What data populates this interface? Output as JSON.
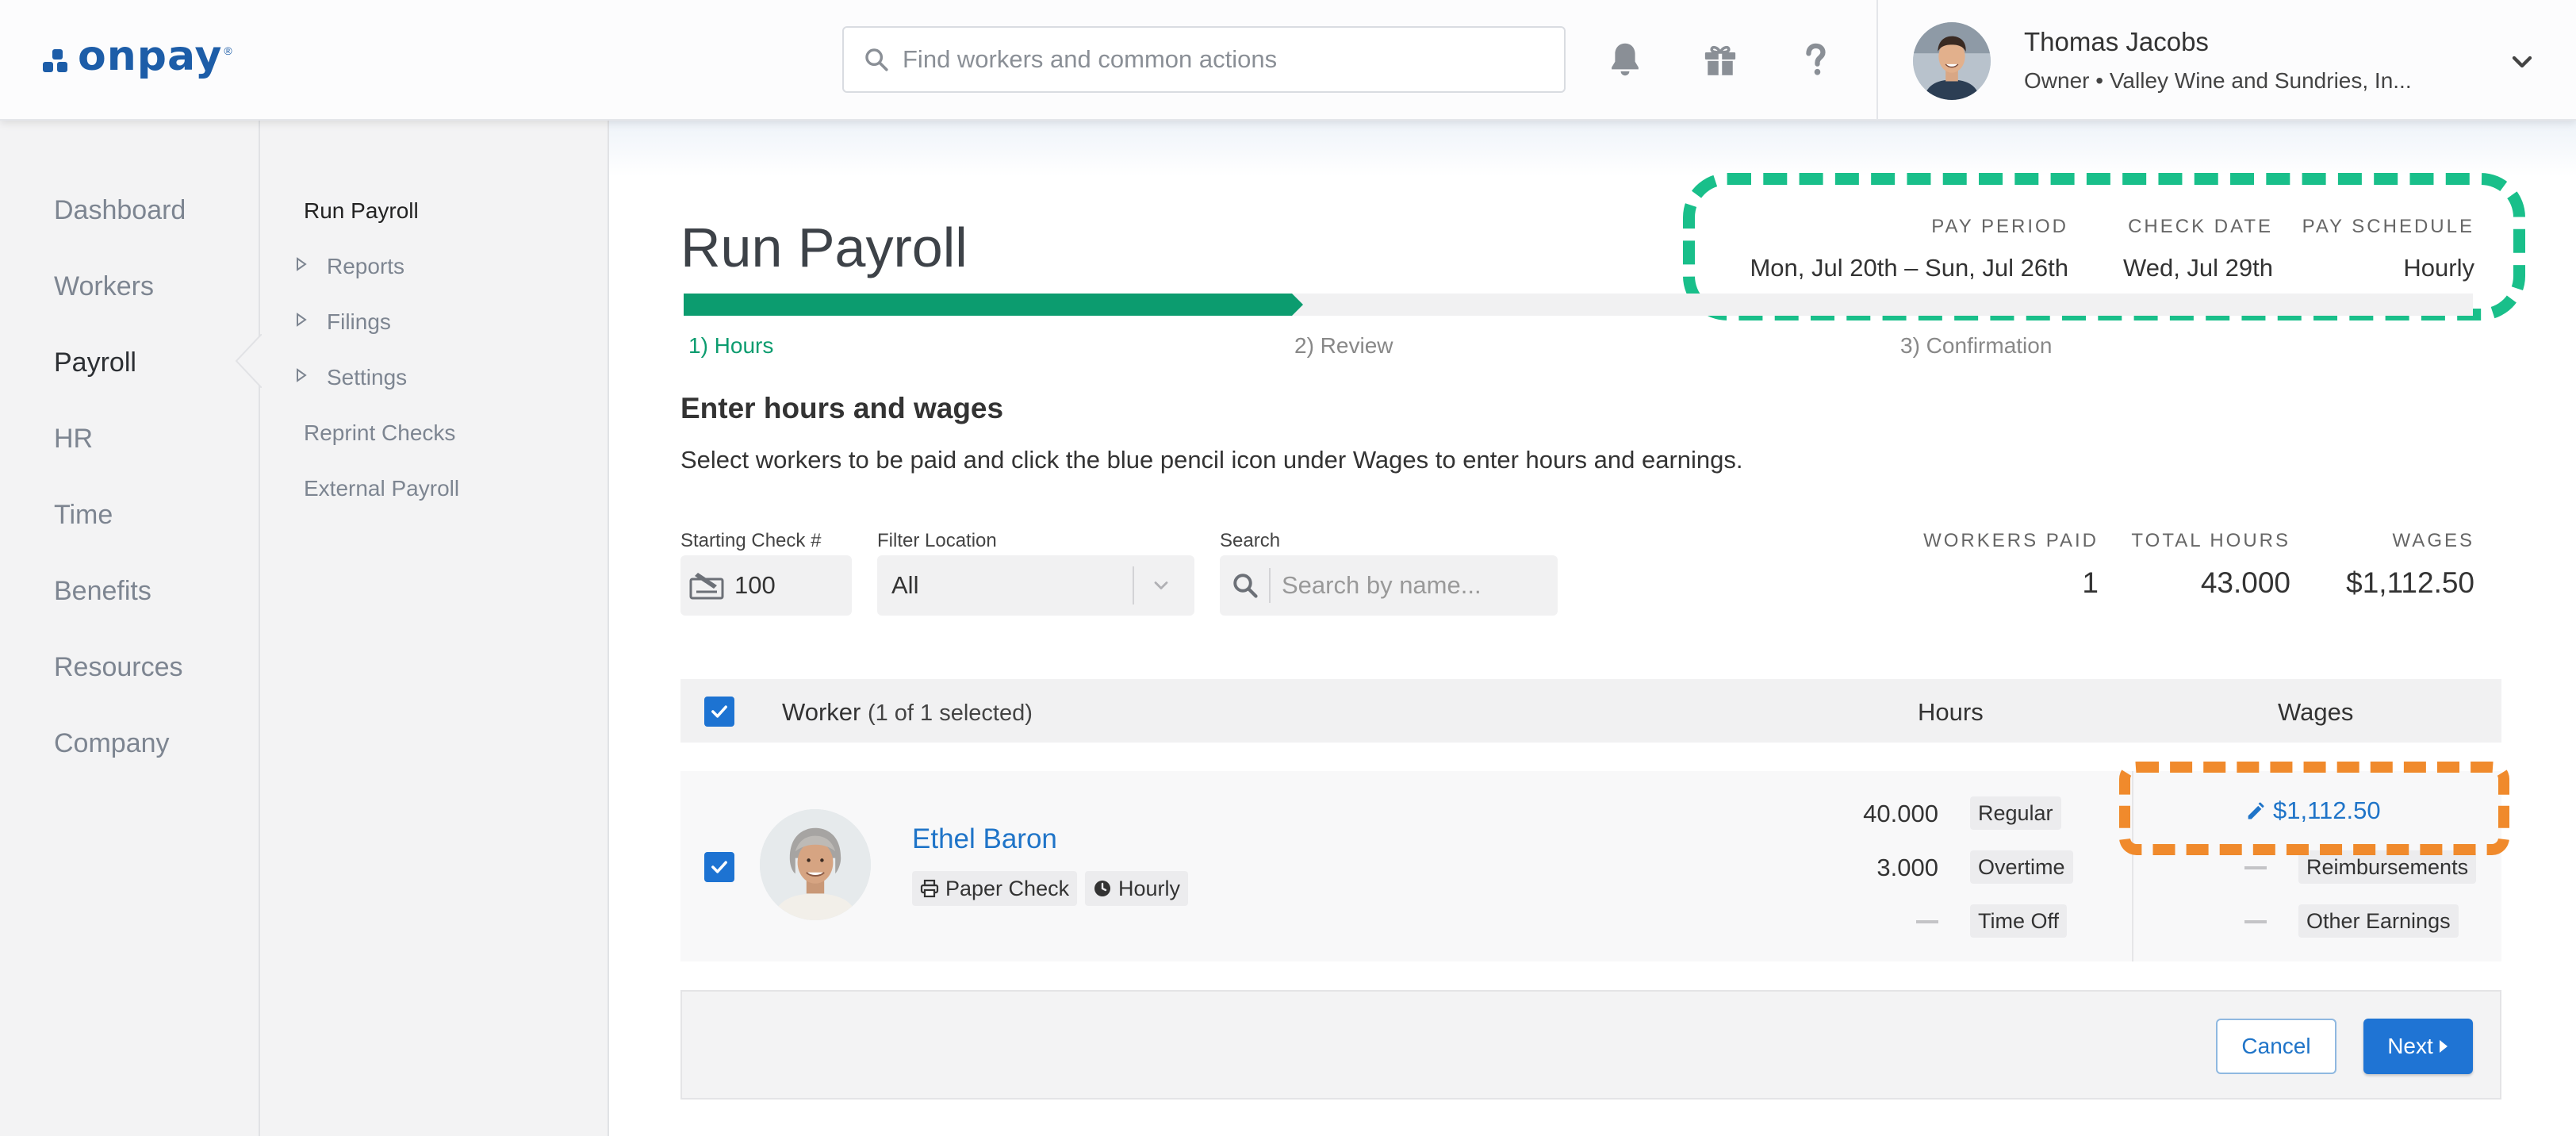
{
  "brand": {
    "name": "onpay",
    "registered_mark": "®",
    "color": "#1d5da8"
  },
  "header": {
    "search_placeholder": "Find workers and common actions",
    "icons": [
      "bell-icon",
      "gift-icon",
      "help-icon"
    ],
    "user": {
      "name": "Thomas Jacobs",
      "role": "Owner • Valley Wine and Sundries, In..."
    }
  },
  "sidebar": {
    "items": [
      {
        "label": "Dashboard",
        "active": false
      },
      {
        "label": "Workers",
        "active": false
      },
      {
        "label": "Payroll",
        "active": true
      },
      {
        "label": "HR",
        "active": false
      },
      {
        "label": "Time",
        "active": false
      },
      {
        "label": "Benefits",
        "active": false
      },
      {
        "label": "Resources",
        "active": false
      },
      {
        "label": "Company",
        "active": false
      }
    ]
  },
  "subnav": {
    "items": [
      {
        "label": "Run Payroll",
        "current": true,
        "expandable": false
      },
      {
        "label": "Reports",
        "current": false,
        "expandable": true
      },
      {
        "label": "Filings",
        "current": false,
        "expandable": true
      },
      {
        "label": "Settings",
        "current": false,
        "expandable": true
      },
      {
        "label": "Reprint Checks",
        "current": false,
        "expandable": false
      },
      {
        "label": "External Payroll",
        "current": false,
        "expandable": false
      }
    ]
  },
  "page": {
    "title": "Run Payroll",
    "pay_period": {
      "label": "PAY PERIOD",
      "value": "Mon, Jul 20th – Sun, Jul 26th"
    },
    "check_date": {
      "label": "CHECK DATE",
      "value": "Wed, Jul 29th"
    },
    "pay_schedule": {
      "label": "PAY SCHEDULE",
      "value": "Hourly"
    },
    "steps": [
      {
        "label": "1) Hours",
        "active": true
      },
      {
        "label": "2) Review",
        "active": false
      },
      {
        "label": "3) Confirmation",
        "active": false
      }
    ],
    "progress_fraction": 0.34,
    "section_title": "Enter hours and wages",
    "section_desc": "Select workers to be paid and click the blue pencil icon under Wages to enter hours and earnings."
  },
  "filters": {
    "starting_check": {
      "label": "Starting Check #",
      "value": "100"
    },
    "location": {
      "label": "Filter Location",
      "value": "All"
    },
    "search": {
      "label": "Search",
      "placeholder": "Search by name..."
    }
  },
  "stats": {
    "workers_paid": {
      "label": "WORKERS PAID",
      "value": "1"
    },
    "total_hours": {
      "label": "TOTAL HOURS",
      "value": "43.000"
    },
    "wages": {
      "label": "WAGES",
      "value": "$1,112.50"
    }
  },
  "table": {
    "worker_header": "Worker",
    "selection_note": "(1 of 1 selected)",
    "hours_header": "Hours",
    "wages_header": "Wages",
    "rows": [
      {
        "name": "Ethel Baron",
        "payment_method": "Paper Check",
        "pay_type": "Hourly",
        "selected": true,
        "hours": [
          {
            "value": "40.000",
            "label": "Regular"
          },
          {
            "value": "3.000",
            "label": "Overtime"
          },
          {
            "value": "—",
            "label": "Time Off"
          }
        ],
        "wage_amount": "$1,112.50",
        "wage_items": [
          {
            "value": "—",
            "label": "Reimbursements"
          },
          {
            "value": "—",
            "label": "Other Earnings"
          }
        ]
      }
    ]
  },
  "actions": {
    "cancel": "Cancel",
    "next": "Next"
  },
  "colors": {
    "accent_blue": "#1f74d4",
    "progress_green": "#0c9c6f",
    "highlight_green": "#19bf8a",
    "highlight_orange": "#f08a2c"
  }
}
